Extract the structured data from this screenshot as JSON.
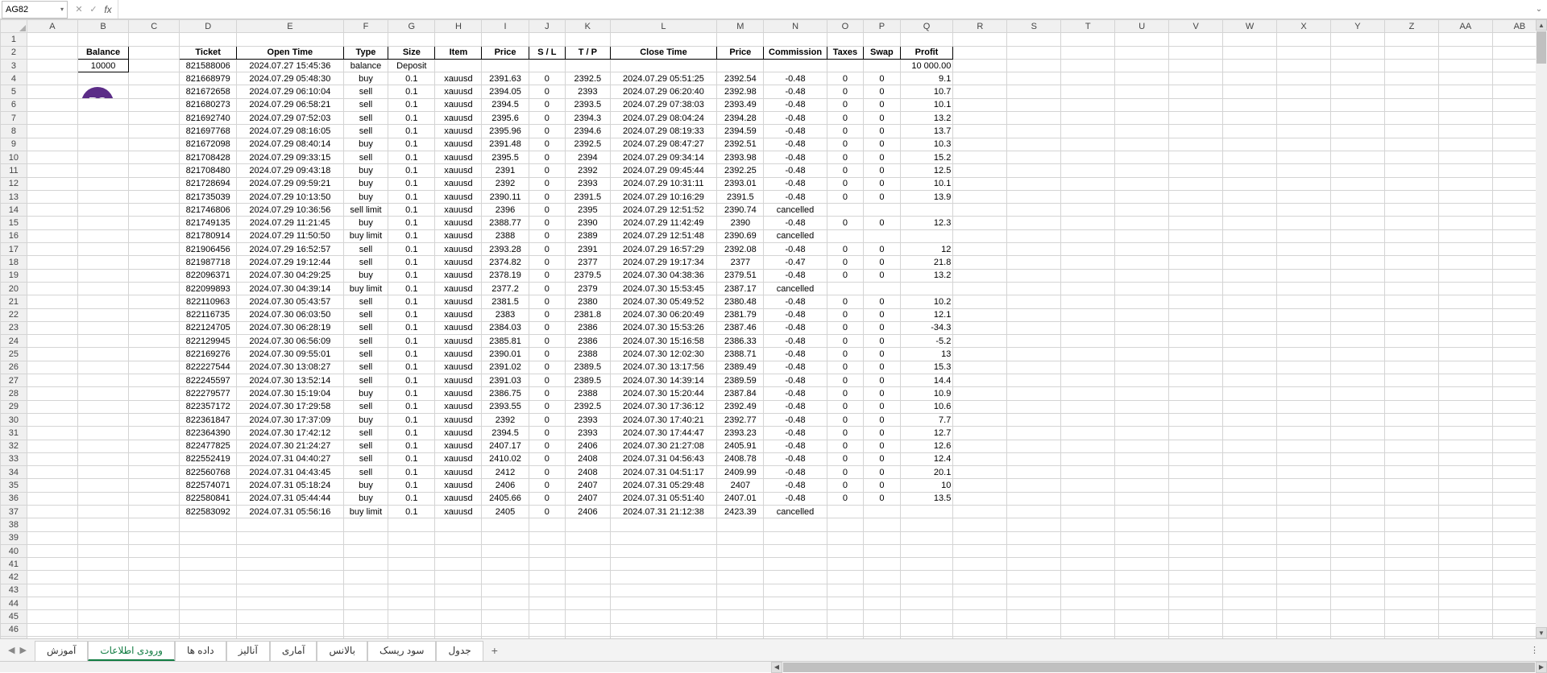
{
  "name_box": "AG82",
  "formula": "",
  "balance_label": "Balance",
  "balance_value": "10000",
  "columns": [
    "A",
    "B",
    "C",
    "D",
    "E",
    "F",
    "G",
    "H",
    "I",
    "J",
    "K",
    "L",
    "M",
    "N",
    "O",
    "P",
    "Q",
    "R",
    "S",
    "T",
    "U",
    "V",
    "W",
    "X",
    "Y",
    "Z",
    "AA",
    "AB"
  ],
  "headers": [
    "Ticket",
    "Open Time",
    "Type",
    "Size",
    "Item",
    "Price",
    "S / L",
    "T / P",
    "Close Time",
    "Price",
    "Commission",
    "Taxes",
    "Swap",
    "Profit"
  ],
  "rows": [
    [
      "821588006",
      "2024.07.27 15:45:36",
      "balance",
      "Deposit",
      "",
      "",
      "",
      "",
      "",
      "",
      "",
      "",
      "",
      "10 000.00"
    ],
    [
      "821668979",
      "2024.07.29 05:48:30",
      "buy",
      "0.1",
      "xauusd",
      "2391.63",
      "0",
      "2392.5",
      "2024.07.29 05:51:25",
      "2392.54",
      "-0.48",
      "0",
      "0",
      "9.1"
    ],
    [
      "821672658",
      "2024.07.29 06:10:04",
      "sell",
      "0.1",
      "xauusd",
      "2394.05",
      "0",
      "2393",
      "2024.07.29 06:20:40",
      "2392.98",
      "-0.48",
      "0",
      "0",
      "10.7"
    ],
    [
      "821680273",
      "2024.07.29 06:58:21",
      "sell",
      "0.1",
      "xauusd",
      "2394.5",
      "0",
      "2393.5",
      "2024.07.29 07:38:03",
      "2393.49",
      "-0.48",
      "0",
      "0",
      "10.1"
    ],
    [
      "821692740",
      "2024.07.29 07:52:03",
      "sell",
      "0.1",
      "xauusd",
      "2395.6",
      "0",
      "2394.3",
      "2024.07.29 08:04:24",
      "2394.28",
      "-0.48",
      "0",
      "0",
      "13.2"
    ],
    [
      "821697768",
      "2024.07.29 08:16:05",
      "sell",
      "0.1",
      "xauusd",
      "2395.96",
      "0",
      "2394.6",
      "2024.07.29 08:19:33",
      "2394.59",
      "-0.48",
      "0",
      "0",
      "13.7"
    ],
    [
      "821672098",
      "2024.07.29 08:40:14",
      "buy",
      "0.1",
      "xauusd",
      "2391.48",
      "0",
      "2392.5",
      "2024.07.29 08:47:27",
      "2392.51",
      "-0.48",
      "0",
      "0",
      "10.3"
    ],
    [
      "821708428",
      "2024.07.29 09:33:15",
      "sell",
      "0.1",
      "xauusd",
      "2395.5",
      "0",
      "2394",
      "2024.07.29 09:34:14",
      "2393.98",
      "-0.48",
      "0",
      "0",
      "15.2"
    ],
    [
      "821708480",
      "2024.07.29 09:43:18",
      "buy",
      "0.1",
      "xauusd",
      "2391",
      "0",
      "2392",
      "2024.07.29 09:45:44",
      "2392.25",
      "-0.48",
      "0",
      "0",
      "12.5"
    ],
    [
      "821728694",
      "2024.07.29 09:59:21",
      "buy",
      "0.1",
      "xauusd",
      "2392",
      "0",
      "2393",
      "2024.07.29 10:31:11",
      "2393.01",
      "-0.48",
      "0",
      "0",
      "10.1"
    ],
    [
      "821735039",
      "2024.07.29 10:13:50",
      "buy",
      "0.1",
      "xauusd",
      "2390.11",
      "0",
      "2391.5",
      "2024.07.29 10:16:29",
      "2391.5",
      "-0.48",
      "0",
      "0",
      "13.9"
    ],
    [
      "821746806",
      "2024.07.29 10:36:56",
      "sell limit",
      "0.1",
      "xauusd",
      "2396",
      "0",
      "2395",
      "2024.07.29 12:51:52",
      "2390.74",
      "cancelled",
      "",
      "",
      ""
    ],
    [
      "821749135",
      "2024.07.29 11:21:45",
      "buy",
      "0.1",
      "xauusd",
      "2388.77",
      "0",
      "2390",
      "2024.07.29 11:42:49",
      "2390",
      "-0.48",
      "0",
      "0",
      "12.3"
    ],
    [
      "821780914",
      "2024.07.29 11:50:50",
      "buy limit",
      "0.1",
      "xauusd",
      "2388",
      "0",
      "2389",
      "2024.07.29 12:51:48",
      "2390.69",
      "cancelled",
      "",
      "",
      ""
    ],
    [
      "821906456",
      "2024.07.29 16:52:57",
      "sell",
      "0.1",
      "xauusd",
      "2393.28",
      "0",
      "2391",
      "2024.07.29 16:57:29",
      "2392.08",
      "-0.48",
      "0",
      "0",
      "12"
    ],
    [
      "821987718",
      "2024.07.29 19:12:44",
      "sell",
      "0.1",
      "xauusd",
      "2374.82",
      "0",
      "2377",
      "2024.07.29 19:17:34",
      "2377",
      "-0.47",
      "0",
      "0",
      "21.8"
    ],
    [
      "822096371",
      "2024.07.30 04:29:25",
      "buy",
      "0.1",
      "xauusd",
      "2378.19",
      "0",
      "2379.5",
      "2024.07.30 04:38:36",
      "2379.51",
      "-0.48",
      "0",
      "0",
      "13.2"
    ],
    [
      "822099893",
      "2024.07.30 04:39:14",
      "buy limit",
      "0.1",
      "xauusd",
      "2377.2",
      "0",
      "2379",
      "2024.07.30 15:53:45",
      "2387.17",
      "cancelled",
      "",
      "",
      ""
    ],
    [
      "822110963",
      "2024.07.30 05:43:57",
      "sell",
      "0.1",
      "xauusd",
      "2381.5",
      "0",
      "2380",
      "2024.07.30 05:49:52",
      "2380.48",
      "-0.48",
      "0",
      "0",
      "10.2"
    ],
    [
      "822116735",
      "2024.07.30 06:03:50",
      "sell",
      "0.1",
      "xauusd",
      "2383",
      "0",
      "2381.8",
      "2024.07.30 06:20:49",
      "2381.79",
      "-0.48",
      "0",
      "0",
      "12.1"
    ],
    [
      "822124705",
      "2024.07.30 06:28:19",
      "sell",
      "0.1",
      "xauusd",
      "2384.03",
      "0",
      "2386",
      "2024.07.30 15:53:26",
      "2387.46",
      "-0.48",
      "0",
      "0",
      "-34.3"
    ],
    [
      "822129945",
      "2024.07.30 06:56:09",
      "sell",
      "0.1",
      "xauusd",
      "2385.81",
      "0",
      "2386",
      "2024.07.30 15:16:58",
      "2386.33",
      "-0.48",
      "0",
      "0",
      "-5.2"
    ],
    [
      "822169276",
      "2024.07.30 09:55:01",
      "sell",
      "0.1",
      "xauusd",
      "2390.01",
      "0",
      "2388",
      "2024.07.30 12:02:30",
      "2388.71",
      "-0.48",
      "0",
      "0",
      "13"
    ],
    [
      "822227544",
      "2024.07.30 13:08:27",
      "sell",
      "0.1",
      "xauusd",
      "2391.02",
      "0",
      "2389.5",
      "2024.07.30 13:17:56",
      "2389.49",
      "-0.48",
      "0",
      "0",
      "15.3"
    ],
    [
      "822245597",
      "2024.07.30 13:52:14",
      "sell",
      "0.1",
      "xauusd",
      "2391.03",
      "0",
      "2389.5",
      "2024.07.30 14:39:14",
      "2389.59",
      "-0.48",
      "0",
      "0",
      "14.4"
    ],
    [
      "822279577",
      "2024.07.30 15:19:04",
      "buy",
      "0.1",
      "xauusd",
      "2386.75",
      "0",
      "2388",
      "2024.07.30 15:20:44",
      "2387.84",
      "-0.48",
      "0",
      "0",
      "10.9"
    ],
    [
      "822357172",
      "2024.07.30 17:29:58",
      "sell",
      "0.1",
      "xauusd",
      "2393.55",
      "0",
      "2392.5",
      "2024.07.30 17:36:12",
      "2392.49",
      "-0.48",
      "0",
      "0",
      "10.6"
    ],
    [
      "822361847",
      "2024.07.30 17:37:09",
      "buy",
      "0.1",
      "xauusd",
      "2392",
      "0",
      "2393",
      "2024.07.30 17:40:21",
      "2392.77",
      "-0.48",
      "0",
      "0",
      "7.7"
    ],
    [
      "822364390",
      "2024.07.30 17:42:12",
      "sell",
      "0.1",
      "xauusd",
      "2394.5",
      "0",
      "2393",
      "2024.07.30 17:44:47",
      "2393.23",
      "-0.48",
      "0",
      "0",
      "12.7"
    ],
    [
      "822477825",
      "2024.07.30 21:24:27",
      "sell",
      "0.1",
      "xauusd",
      "2407.17",
      "0",
      "2406",
      "2024.07.30 21:27:08",
      "2405.91",
      "-0.48",
      "0",
      "0",
      "12.6"
    ],
    [
      "822552419",
      "2024.07.31 04:40:27",
      "sell",
      "0.1",
      "xauusd",
      "2410.02",
      "0",
      "2408",
      "2024.07.31 04:56:43",
      "2408.78",
      "-0.48",
      "0",
      "0",
      "12.4"
    ],
    [
      "822560768",
      "2024.07.31 04:43:45",
      "sell",
      "0.1",
      "xauusd",
      "2412",
      "0",
      "2408",
      "2024.07.31 04:51:17",
      "2409.99",
      "-0.48",
      "0",
      "0",
      "20.1"
    ],
    [
      "822574071",
      "2024.07.31 05:18:24",
      "buy",
      "0.1",
      "xauusd",
      "2406",
      "0",
      "2407",
      "2024.07.31 05:29:48",
      "2407",
      "-0.48",
      "0",
      "0",
      "10"
    ],
    [
      "822580841",
      "2024.07.31 05:44:44",
      "buy",
      "0.1",
      "xauusd",
      "2405.66",
      "0",
      "2407",
      "2024.07.31 05:51:40",
      "2407.01",
      "-0.48",
      "0",
      "0",
      "13.5"
    ],
    [
      "822583092",
      "2024.07.31 05:56:16",
      "buy limit",
      "0.1",
      "xauusd",
      "2405",
      "0",
      "2406",
      "2024.07.31 21:12:38",
      "2423.39",
      "cancelled",
      "",
      "",
      ""
    ]
  ],
  "tabs": [
    "آموزش",
    "ورودی اطلاعات",
    "داده ها",
    "آنالیز",
    "آماری",
    "بالانس",
    "سود ریسک",
    "جدول"
  ],
  "active_tab": 1,
  "logo_text": "RS"
}
